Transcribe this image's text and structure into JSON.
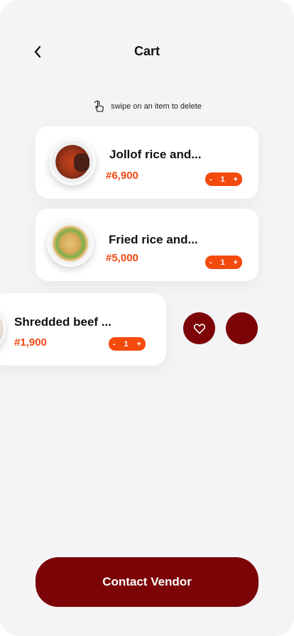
{
  "header": {
    "title": "Cart",
    "back_icon": "chevron-left-icon"
  },
  "hint": {
    "text": "swipe on an item to delete",
    "icon": "swipe-hand-icon"
  },
  "items": [
    {
      "name": "Jollof rice and...",
      "price": "#6,900",
      "quantity": "1",
      "minus": "-",
      "plus": "+"
    },
    {
      "name": "Fried rice and...",
      "price": "#5,000",
      "quantity": "1",
      "minus": "-",
      "plus": "+"
    },
    {
      "name": "Shredded beef ...",
      "price": "#1,900",
      "quantity": "1",
      "minus": "-",
      "plus": "+"
    }
  ],
  "swipe_actions": {
    "favorite_icon": "heart-icon",
    "delete_icon": "delete-icon"
  },
  "footer": {
    "contact_label": "Contact Vendor"
  },
  "colors": {
    "accent": "#f34a0d",
    "primary": "#7c0406",
    "background": "#f4f4f7"
  }
}
